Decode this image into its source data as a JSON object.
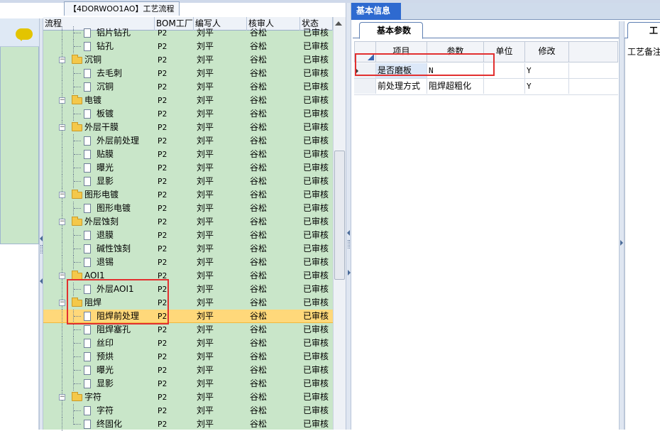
{
  "tree_panel": {
    "tab_label": "【4DORWOO1AO】工艺流程",
    "columns": [
      "流程",
      "BOM工厂",
      "编写人",
      "核审人",
      "状态"
    ],
    "rows": [
      {
        "name": "铝片钻孔",
        "bom": "P2",
        "writer": "刘平",
        "reviewer": "谷松",
        "status": "已审核",
        "type": "doc",
        "indent": 1
      },
      {
        "name": "钻孔",
        "bom": "P2",
        "writer": "刘平",
        "reviewer": "谷松",
        "status": "已审核",
        "type": "doc",
        "indent": 1
      },
      {
        "name": "沉铜",
        "bom": "P2",
        "writer": "刘平",
        "reviewer": "谷松",
        "status": "已审核",
        "type": "folder",
        "indent": 0
      },
      {
        "name": "去毛刺",
        "bom": "P2",
        "writer": "刘平",
        "reviewer": "谷松",
        "status": "已审核",
        "type": "doc",
        "indent": 1
      },
      {
        "name": "沉铜",
        "bom": "P2",
        "writer": "刘平",
        "reviewer": "谷松",
        "status": "已审核",
        "type": "doc",
        "indent": 1
      },
      {
        "name": "电镀",
        "bom": "P2",
        "writer": "刘平",
        "reviewer": "谷松",
        "status": "已审核",
        "type": "folder",
        "indent": 0
      },
      {
        "name": "板镀",
        "bom": "P2",
        "writer": "刘平",
        "reviewer": "谷松",
        "status": "已审核",
        "type": "doc",
        "indent": 1
      },
      {
        "name": "外层干膜",
        "bom": "P2",
        "writer": "刘平",
        "reviewer": "谷松",
        "status": "已审核",
        "type": "folder",
        "indent": 0
      },
      {
        "name": "外层前处理",
        "bom": "P2",
        "writer": "刘平",
        "reviewer": "谷松",
        "status": "已审核",
        "type": "doc",
        "indent": 1
      },
      {
        "name": "贴膜",
        "bom": "P2",
        "writer": "刘平",
        "reviewer": "谷松",
        "status": "已审核",
        "type": "doc",
        "indent": 1
      },
      {
        "name": "曝光",
        "bom": "P2",
        "writer": "刘平",
        "reviewer": "谷松",
        "status": "已审核",
        "type": "doc",
        "indent": 1
      },
      {
        "name": "显影",
        "bom": "P2",
        "writer": "刘平",
        "reviewer": "谷松",
        "status": "已审核",
        "type": "doc",
        "indent": 1
      },
      {
        "name": "图形电镀",
        "bom": "P2",
        "writer": "刘平",
        "reviewer": "谷松",
        "status": "已审核",
        "type": "folder",
        "indent": 0
      },
      {
        "name": "图形电镀",
        "bom": "P2",
        "writer": "刘平",
        "reviewer": "谷松",
        "status": "已审核",
        "type": "doc",
        "indent": 1
      },
      {
        "name": "外层蚀刻",
        "bom": "P2",
        "writer": "刘平",
        "reviewer": "谷松",
        "status": "已审核",
        "type": "folder",
        "indent": 0
      },
      {
        "name": "退膜",
        "bom": "P2",
        "writer": "刘平",
        "reviewer": "谷松",
        "status": "已审核",
        "type": "doc",
        "indent": 1
      },
      {
        "name": "碱性蚀刻",
        "bom": "P2",
        "writer": "刘平",
        "reviewer": "谷松",
        "status": "已审核",
        "type": "doc",
        "indent": 1
      },
      {
        "name": "退锡",
        "bom": "P2",
        "writer": "刘平",
        "reviewer": "谷松",
        "status": "已审核",
        "type": "doc",
        "indent": 1
      },
      {
        "name": "AOI1",
        "bom": "P2",
        "writer": "刘平",
        "reviewer": "谷松",
        "status": "已审核",
        "type": "folder",
        "indent": 0
      },
      {
        "name": "外层AOI1",
        "bom": "P2",
        "writer": "刘平",
        "reviewer": "谷松",
        "status": "已审核",
        "type": "doc",
        "indent": 1
      },
      {
        "name": "阻焊",
        "bom": "P2",
        "writer": "刘平",
        "reviewer": "谷松",
        "status": "已审核",
        "type": "folder",
        "indent": 0
      },
      {
        "name": "阻焊前处理",
        "bom": "P2",
        "writer": "刘平",
        "reviewer": "谷松",
        "status": "已审核",
        "type": "doc",
        "indent": 1,
        "selected": true
      },
      {
        "name": "阻焊塞孔",
        "bom": "P2",
        "writer": "刘平",
        "reviewer": "谷松",
        "status": "已审核",
        "type": "doc",
        "indent": 1
      },
      {
        "name": "丝印",
        "bom": "P2",
        "writer": "刘平",
        "reviewer": "谷松",
        "status": "已审核",
        "type": "doc",
        "indent": 1
      },
      {
        "name": "预烘",
        "bom": "P2",
        "writer": "刘平",
        "reviewer": "谷松",
        "status": "已审核",
        "type": "doc",
        "indent": 1
      },
      {
        "name": "曝光",
        "bom": "P2",
        "writer": "刘平",
        "reviewer": "谷松",
        "status": "已审核",
        "type": "doc",
        "indent": 1
      },
      {
        "name": "显影",
        "bom": "P2",
        "writer": "刘平",
        "reviewer": "谷松",
        "status": "已审核",
        "type": "doc",
        "indent": 1
      },
      {
        "name": "字符",
        "bom": "P2",
        "writer": "刘平",
        "reviewer": "谷松",
        "status": "已审核",
        "type": "folder",
        "indent": 0
      },
      {
        "name": "字符",
        "bom": "P2",
        "writer": "刘平",
        "reviewer": "谷松",
        "status": "已审核",
        "type": "doc",
        "indent": 1
      },
      {
        "name": "终固化",
        "bom": "P2",
        "writer": "刘平",
        "reviewer": "谷松",
        "status": "已审核",
        "type": "doc",
        "indent": 1
      }
    ]
  },
  "right_panel": {
    "main_tab": "基本信息",
    "sub_tab": "基本参数",
    "grid": {
      "columns": [
        "项目",
        "参数",
        "单位",
        "修改"
      ],
      "rows": [
        {
          "item": "是否磨板",
          "param": "N",
          "unit": "",
          "modify": "Y"
        },
        {
          "item": "前处理方式",
          "param": "阻焊超粗化",
          "unit": "",
          "modify": "Y"
        }
      ]
    },
    "side_tab": "工",
    "side_label": "工艺备注"
  },
  "colors": {
    "tree_bg": "#c9e6c9",
    "selected_row": "#ffd87a",
    "tab_active": "#2e6ad0",
    "highlight_box": "#e23030"
  }
}
